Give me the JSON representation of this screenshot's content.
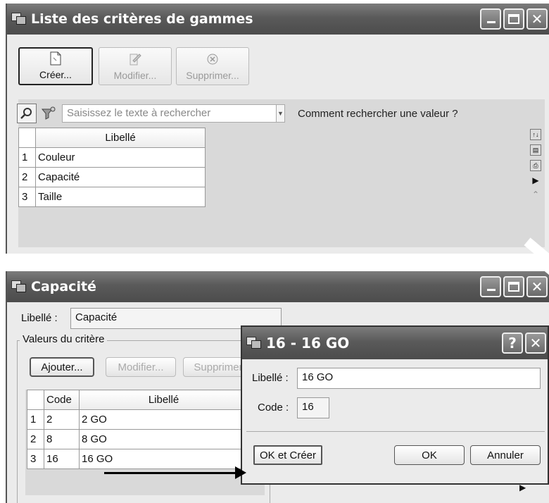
{
  "window1": {
    "title": "Liste des critères de gammes",
    "toolbar": {
      "create_label": "Créer...",
      "edit_label": "Modifier...",
      "delete_label": "Supprimer..."
    },
    "search": {
      "placeholder": "Saisissez le texte à rechercher",
      "hint": "Comment rechercher une valeur ?"
    },
    "table": {
      "header": "Libellé",
      "rows": [
        {
          "num": "1",
          "label": "Couleur"
        },
        {
          "num": "2",
          "label": "Capacité"
        },
        {
          "num": "3",
          "label": "Taille"
        }
      ]
    }
  },
  "window2": {
    "title": "Capacité",
    "label_caption": "Libellé :",
    "label_value": "Capacité",
    "group_title": "Valeurs du critère",
    "buttons": {
      "add": "Ajouter...",
      "edit": "Modifier...",
      "delete": "Supprimer"
    },
    "table": {
      "headers": [
        "Code",
        "Libellé"
      ],
      "rows": [
        {
          "num": "1",
          "code": "2",
          "label": "2 GO"
        },
        {
          "num": "2",
          "code": "8",
          "label": "8 GO"
        },
        {
          "num": "3",
          "code": "16",
          "label": "16 GO"
        }
      ]
    }
  },
  "dialog": {
    "title": "16 - 16 GO",
    "label_caption": "Libellé :",
    "label_value": "16 GO",
    "code_caption": "Code :",
    "code_value": "16",
    "buttons": {
      "ok_create": "OK et Créer",
      "ok": "OK",
      "cancel": "Annuler"
    }
  }
}
